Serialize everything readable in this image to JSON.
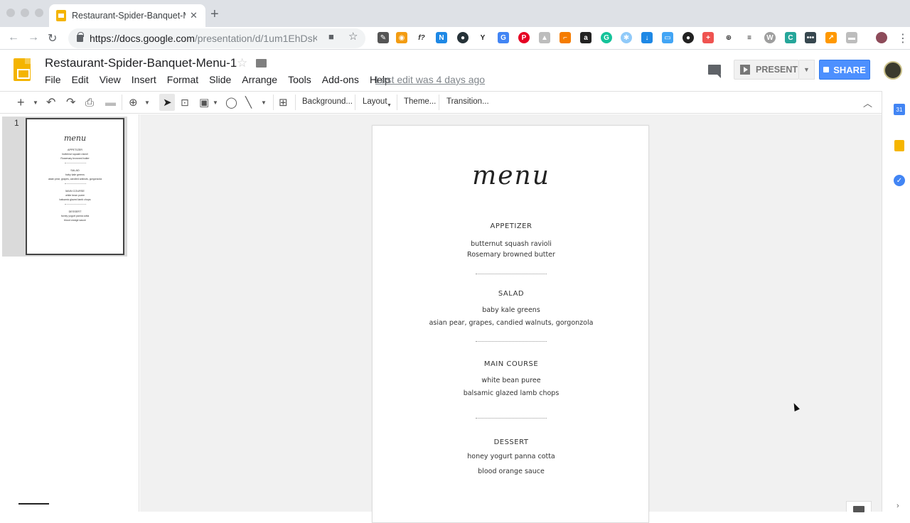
{
  "browser": {
    "tab_title": "Restaurant-Spider-Banquet-M",
    "url_host": "https://docs.google.com",
    "url_path": "/presentation/d/1um1EhDsK..."
  },
  "app": {
    "doc_title": "Restaurant-Spider-Banquet-Menu-1",
    "menus": [
      "File",
      "Edit",
      "View",
      "Insert",
      "Format",
      "Slide",
      "Arrange",
      "Tools",
      "Add-ons",
      "Help"
    ],
    "last_edit": "Last edit was 4 days ago",
    "present_label": "PRESENT",
    "share_label": "SHARE"
  },
  "toolbar": {
    "background_label": "Background...",
    "layout_label": "Layout",
    "theme_label": "Theme...",
    "transition_label": "Transition..."
  },
  "filmstrip": {
    "slide_number": "1"
  },
  "slide": {
    "title": "menu",
    "sections": [
      {
        "heading": "APPETIZER",
        "items": [
          "butternut squash ravioli",
          "Rosemary browned butter"
        ]
      },
      {
        "heading": "SALAD",
        "items": [
          "baby kale greens",
          "asian pear, grapes, candied walnuts, gorgonzola"
        ]
      },
      {
        "heading": "MAIN COURSE",
        "items": [
          "white bean puree",
          "balsamic glazed lamb chops"
        ]
      },
      {
        "heading": "DESSERT",
        "items": [
          "honey yogurt panna cotta",
          "blood orange sauce"
        ]
      }
    ]
  },
  "sidepanel": {
    "calendar_day": "31"
  },
  "colors": {
    "slides_yellow": "#f4b400",
    "share_blue": "#4d90fe"
  }
}
